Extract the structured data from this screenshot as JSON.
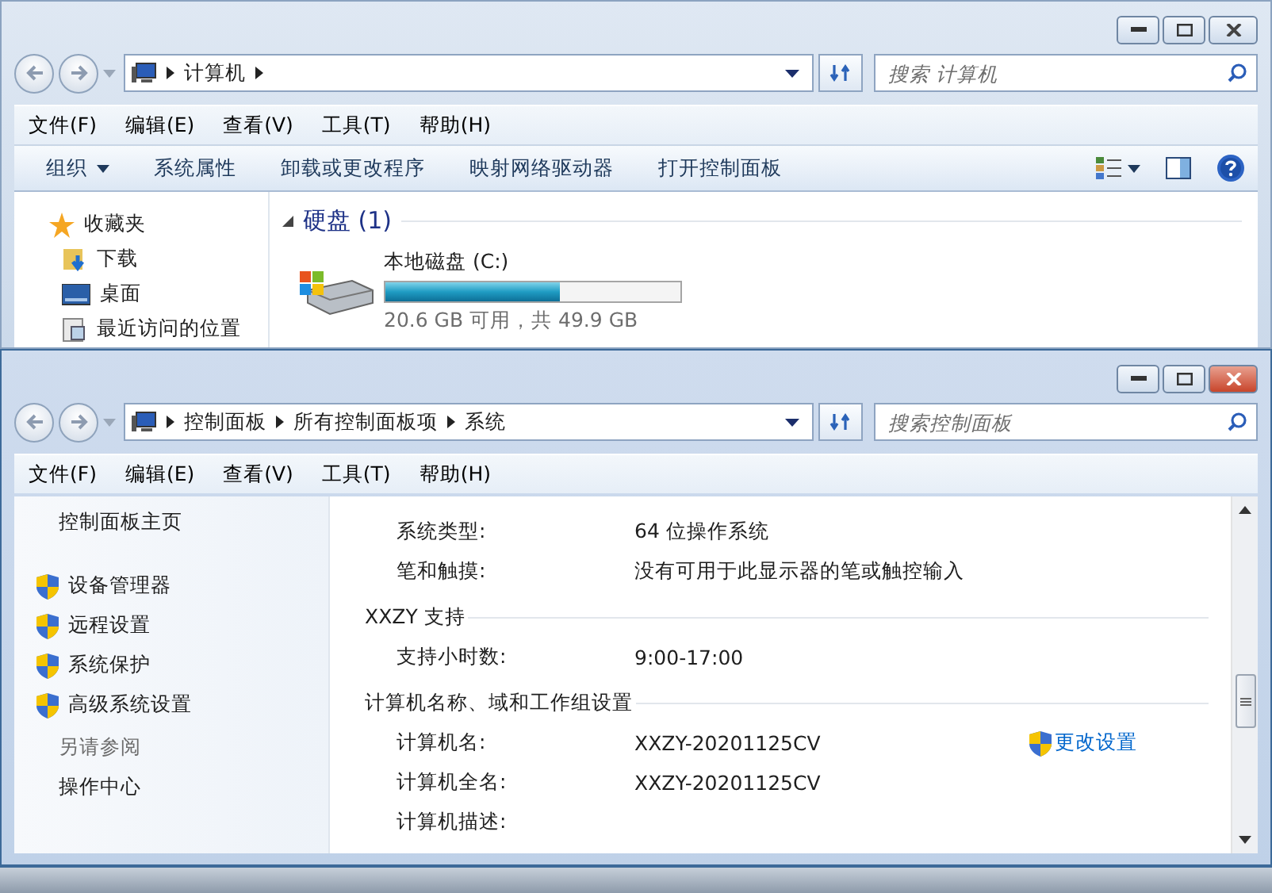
{
  "windows": [
    {
      "active": false,
      "address": {
        "crumbs": [
          "计算机"
        ],
        "more": true
      },
      "search": {
        "placeholder": "搜索 计算机"
      },
      "menu": [
        "文件(F)",
        "编辑(E)",
        "查看(V)",
        "工具(T)",
        "帮助(H)"
      ],
      "commands": [
        {
          "label": "组织",
          "dropdown": true
        },
        {
          "label": "系统属性",
          "dropdown": false
        },
        {
          "label": "卸载或更改程序",
          "dropdown": false
        },
        {
          "label": "映射网络驱动器",
          "dropdown": false
        },
        {
          "label": "打开控制面板",
          "dropdown": false
        }
      ],
      "favorites": {
        "title": "收藏夹",
        "items": [
          {
            "label": "下载",
            "kind": "downloads"
          },
          {
            "label": "桌面",
            "kind": "desktop"
          },
          {
            "label": "最近访问的位置",
            "kind": "recent"
          }
        ]
      },
      "section": {
        "title": "硬盘 (1)",
        "expanded": true,
        "drive": {
          "name": "本地磁盘 (C:)",
          "level": 0.59,
          "reading": "20.6 GB 可用，共 49.9 GB"
        }
      }
    },
    {
      "active": true,
      "address": {
        "crumbs": [
          "控制面板",
          "所有控制面板项",
          "系统"
        ],
        "more": false
      },
      "search": {
        "placeholder": "搜索控制面板"
      },
      "menu": [
        "文件(F)",
        "编辑(E)",
        "查看(V)",
        "工具(T)",
        "帮助(H)"
      ],
      "home": "控制面板主页",
      "tasks": [
        "设备管理器",
        "远程设置",
        "系统保护",
        "高级系统设置"
      ],
      "see_also": {
        "title": "另请参阅",
        "links": [
          "操作中心"
        ]
      },
      "groups": [
        {
          "rows": [
            {
              "label": "系统类型:",
              "value": "64 位操作系统"
            },
            {
              "label": "笔和触摸:",
              "value": "没有可用于此显示器的笔或触控输入"
            }
          ]
        },
        {
          "title": "XXZY 支持",
          "rows": [
            {
              "label": "支持小时数:",
              "value": "9:00-17:00"
            }
          ]
        },
        {
          "title": "计算机名称、域和工作组设置",
          "rows": [
            {
              "label": "计算机名:",
              "value": "XXZY-20201125CV",
              "action": "更改设置"
            },
            {
              "label": "计算机全名:",
              "value": "XXZY-20201125CV"
            },
            {
              "label": "计算机描述:"
            }
          ]
        }
      ]
    }
  ]
}
